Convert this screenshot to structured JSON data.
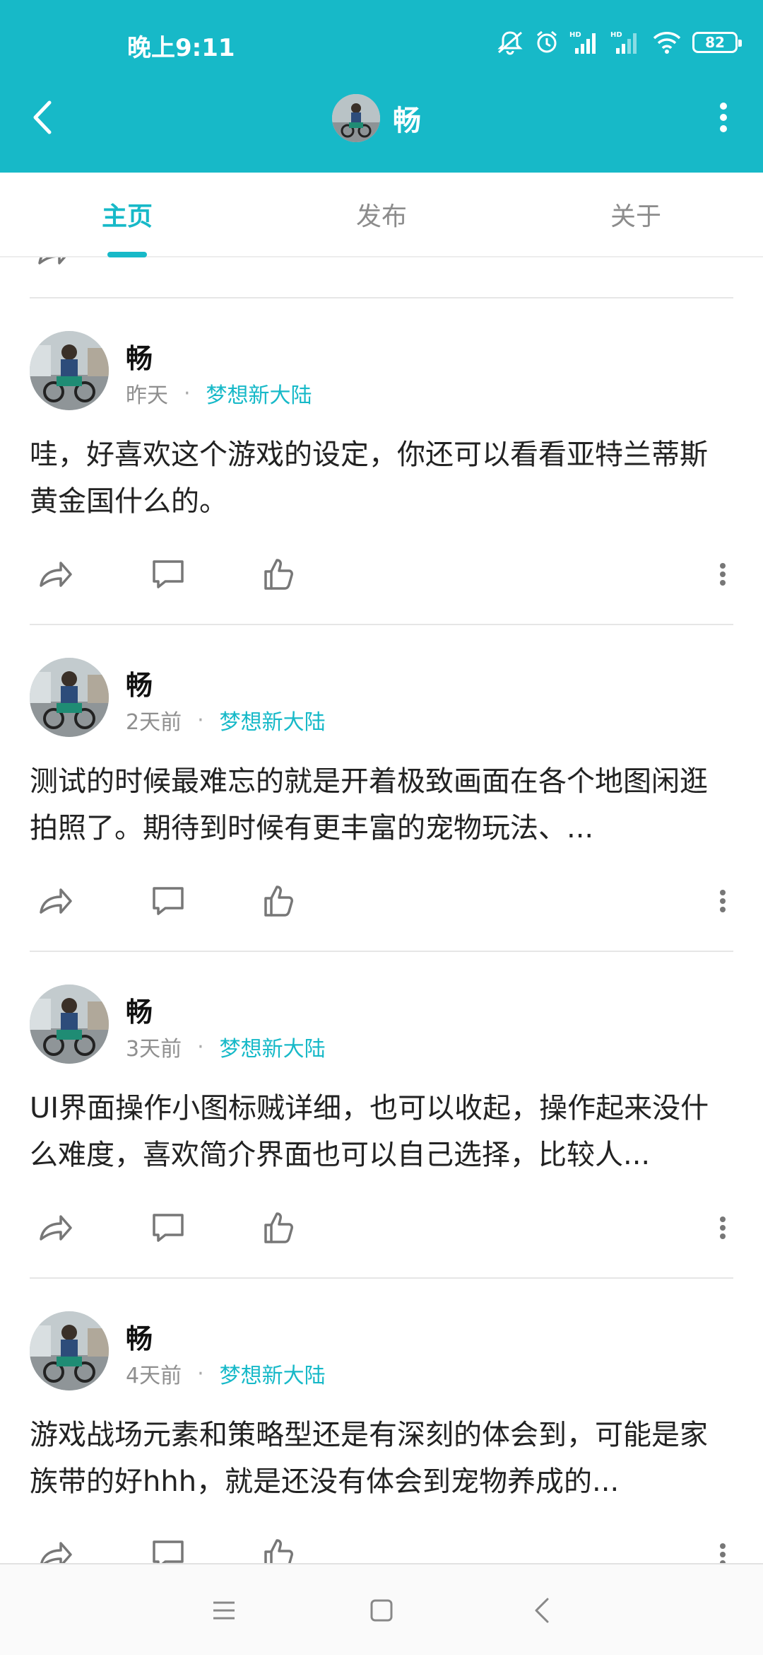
{
  "status_bar": {
    "time": "晚上9:11",
    "battery": "82",
    "icons": [
      "mute-icon",
      "alarm-icon",
      "signal-hd-icon",
      "signal-hd-icon",
      "wifi-icon",
      "battery-icon"
    ]
  },
  "header": {
    "title": "畅",
    "back_icon": "chevron-left-icon",
    "more_icon": "more-vertical-icon"
  },
  "tabs": [
    {
      "label": "主页",
      "active": true
    },
    {
      "label": "发布",
      "active": false
    },
    {
      "label": "关于",
      "active": false
    }
  ],
  "posts": [
    {
      "author": "畅",
      "time": "昨天",
      "forum": "梦想新大陆",
      "text": "哇，好喜欢这个游戏的设定，你还可以看看亚特兰蒂斯黄金国什么的。"
    },
    {
      "author": "畅",
      "time": "2天前",
      "forum": "梦想新大陆",
      "text": "测试的时候最难忘的就是开着极致画面在各个地图闲逛拍照了。期待到时候有更丰富的宠物玩法、..."
    },
    {
      "author": "畅",
      "time": "3天前",
      "forum": "梦想新大陆",
      "text": "UI界面操作小图标贼详细，也可以收起，操作起来没什么难度，喜欢简介界面也可以自己选择，比较人..."
    },
    {
      "author": "畅",
      "time": "4天前",
      "forum": "梦想新大陆",
      "text": "游戏战场元素和策略型还是有深刻的体会到，可能是家族带的好hhh，就是还没有体会到宠物养成的..."
    }
  ],
  "colors": {
    "accent": "#17b9c8",
    "text": "#222222",
    "muted": "#8f8f8f"
  },
  "nav": [
    "menu-icon",
    "home-square-icon",
    "back-triangle-icon"
  ]
}
